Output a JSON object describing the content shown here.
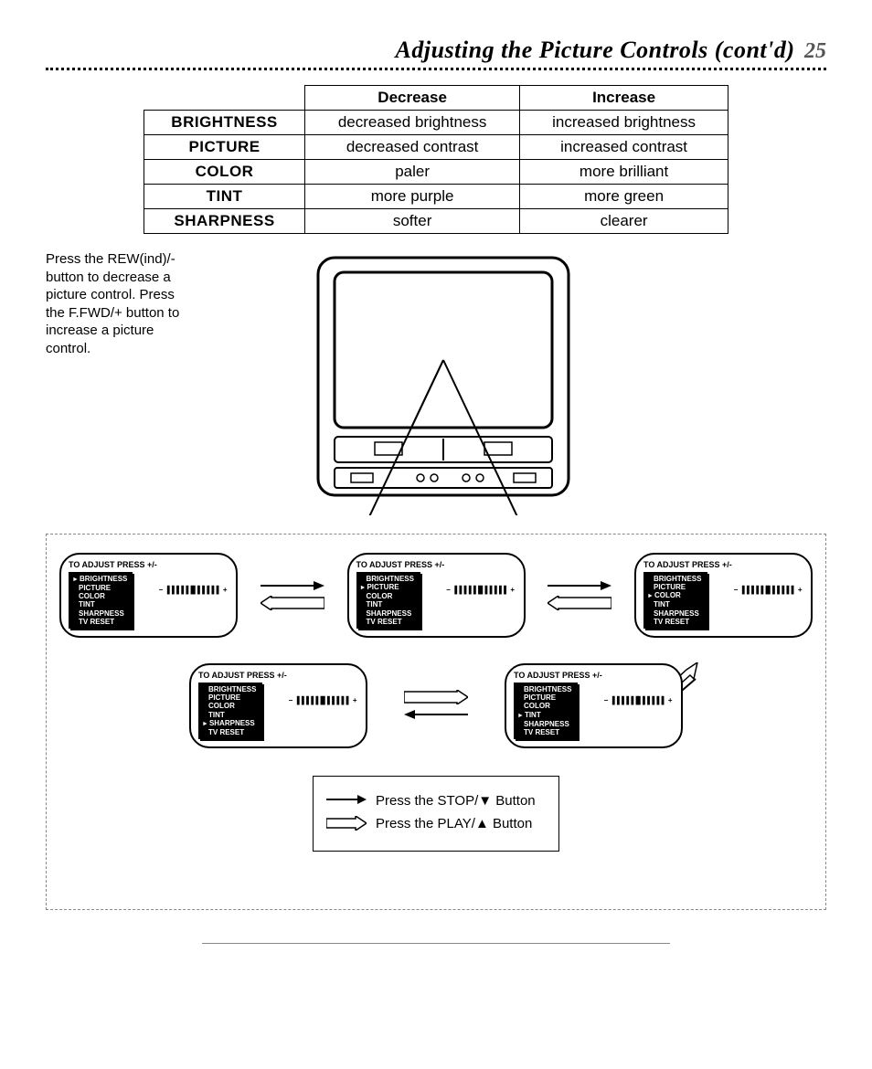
{
  "header": {
    "title": "Adjusting the Picture Controls (cont'd)",
    "page": "25"
  },
  "table": {
    "col_decrease": "Decrease",
    "col_increase": "Increase",
    "rows": [
      {
        "name": "BRIGHTNESS",
        "dec": "decreased brightness",
        "inc": "increased brightness"
      },
      {
        "name": "PICTURE",
        "dec": "decreased contrast",
        "inc": "increased contrast"
      },
      {
        "name": "COLOR",
        "dec": "paler",
        "inc": "more brilliant"
      },
      {
        "name": "TINT",
        "dec": "more purple",
        "inc": "more green"
      },
      {
        "name": "SHARPNESS",
        "dec": "softer",
        "inc": "clearer"
      }
    ]
  },
  "side_note": "Press the REW(ind)/- button to decrease a picture control. Press the F.FWD/+ button to increase a picture control.",
  "osd": {
    "title": "TO ADJUST PRESS +/-",
    "items": [
      "BRIGHTNESS",
      "PICTURE",
      "COLOR",
      "TINT",
      "SHARPNESS",
      "TV RESET"
    ],
    "bar": "▐▐▐▐▐▐▌▌▌▌▌▌",
    "screens": [
      {
        "selected": "BRIGHTNESS"
      },
      {
        "selected": "PICTURE"
      },
      {
        "selected": "COLOR"
      },
      {
        "selected": "SHARPNESS"
      },
      {
        "selected": "TINT"
      }
    ]
  },
  "legend": {
    "stop": "Press the STOP/▼ Button",
    "play": "Press the PLAY/▲ Button"
  }
}
